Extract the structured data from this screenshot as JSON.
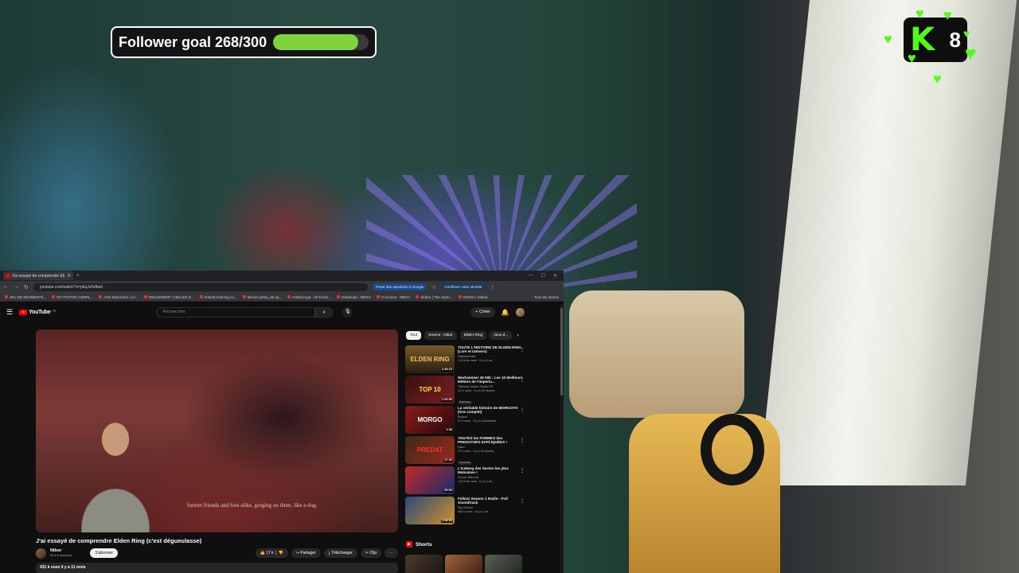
{
  "overlay": {
    "follower_goal_label": "Follower goal 268/300",
    "follower_goal_progress": 0.893,
    "kick_count": "8",
    "accent_color": "#53fc18"
  },
  "browser": {
    "tab_title": "J'ai essayé de comprendre Eld...",
    "url": "youtube.com/watch?v=pkqJv0sfbek",
    "translate_chip": "Poser des questions à Google",
    "identity_chip": "Confirmer votre identité",
    "bookmarks": [
      "JEU DE SEGMENTS...",
      "KIT PISTON COMPL...",
      "ASG Motocarré | Le...",
      "ROULEMENT À BILLES D...",
      "Imtemt-Gaming.co...",
      "Idecart pelep_wit sp...",
      "Hubencrypt - All Tricks...",
      "Download - MEGA",
      "C:/Linux2 - MEGA",
      "Sidera | The Open...",
      "GitbOn | Sidera"
    ],
    "all_bookmarks": "Tous les favoris"
  },
  "youtube": {
    "logo_text": "YouTube",
    "logo_region": "FR",
    "search_placeholder": "Rechercher",
    "create_label": "Créer",
    "video": {
      "subtitle": "former friends and foes alike, gorging on them, like a dog.",
      "title": "J'ai essayé de comprendre Elden Ring (c'est dégueulasse)",
      "channel": "Nibor",
      "subscribers": "54,4 k abonnés",
      "subscribe_label": "S'abonner",
      "likes": "17 k",
      "share_label": "Partager",
      "download_label": "Télécharger",
      "clip_label": "Clip",
      "stats": "431 k vues  il y a 11 mois"
    },
    "filter_chips": [
      "Tout",
      "Source : Nibor",
      "Elden Ring",
      "Jeux d..."
    ],
    "recommendations": [
      {
        "title": "TOUTE L'HISTOIRE DE ELDEN RING (Lore et Univers)",
        "channel": "SkyMarmotte",
        "meta": "1,3 M de vues · il y a 1 an",
        "duration": "2:48:10",
        "thumb_text": "ELDEN RING",
        "badge": ""
      },
      {
        "title": "Warhammer 40 000 : Les 10 Meilleurs Métiers de l'Imperiu...",
        "channel": "Télévisé Vaclav Studio FR",
        "meta": "1,2 k vues · il y a 20 heures",
        "duration": "1:30:06",
        "thumb_text": "TOP 10",
        "badge": "Nouveau"
      },
      {
        "title": "La véritable histoire de MORGOTH (lore complet)",
        "channel": "Boston",
        "meta": "37 k vues · il y a 4 semaines",
        "duration": "4:08",
        "thumb_text": "MORGO",
        "badge": ""
      },
      {
        "title": "TOUTES les FORMES des PREDATORS EXPLIQUÉES !",
        "channel": "Dikor",
        "meta": "27 k vues · il y a 18 heures",
        "duration": "17:32",
        "thumb_text": "PREDAT",
        "badge": "Nouveau"
      },
      {
        "title": "L'Iceberg des Sectes les plus Malsaines !",
        "channel": "Dooxe Wilcroot",
        "meta": "1,8 M de vues · il y a 1 an",
        "duration": "55:09",
        "thumb_text": "",
        "badge": ""
      },
      {
        "title": "Fallout Season 1 Radio - Full Soundtrack",
        "channel": "Sky Gamer",
        "meta": "594 k vues · il y a 1 an",
        "duration": "1:58:53",
        "thumb_text": "",
        "badge": ""
      }
    ],
    "shorts_label": "Shorts"
  }
}
